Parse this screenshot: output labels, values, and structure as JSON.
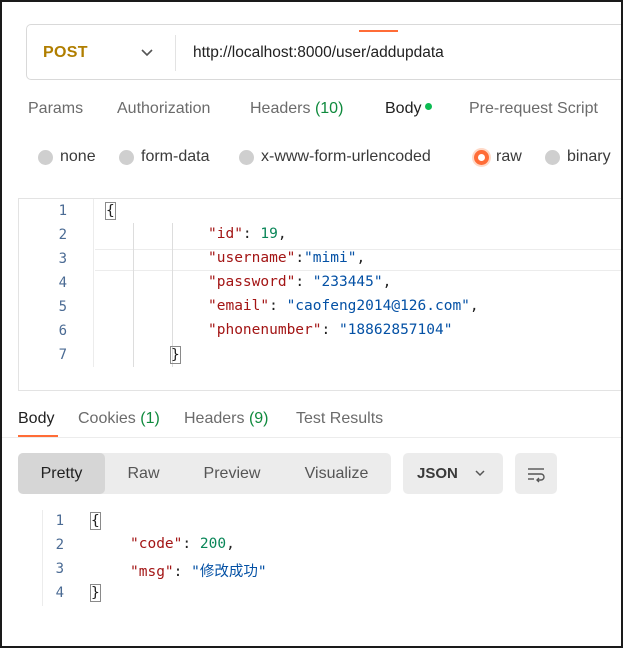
{
  "request": {
    "method": "POST",
    "method_dropdown_icon": "chevron-down-icon",
    "url": "http://localhost:8000/user/addupdata"
  },
  "request_tabs": [
    {
      "label": "Params"
    },
    {
      "label": "Authorization"
    },
    {
      "label": "Headers",
      "count": "(10)"
    },
    {
      "label": "Body",
      "active": true,
      "indicator_color": "#0cbb52"
    },
    {
      "label": "Pre-request Script"
    }
  ],
  "body_types": [
    {
      "label": "none"
    },
    {
      "label": "form-data"
    },
    {
      "label": "x-www-form-urlencoded"
    },
    {
      "label": "raw",
      "selected": true
    },
    {
      "label": "binary"
    }
  ],
  "request_body": {
    "line_numbers": [
      "1",
      "2",
      "3",
      "4",
      "5",
      "6",
      "7"
    ],
    "open_brace": "{",
    "close_brace": "}",
    "fields": [
      {
        "key": "\"id\"",
        "sep": ": ",
        "value": "19",
        "type": "num",
        "tail": ","
      },
      {
        "key": "\"username\"",
        "sep": ":",
        "value": "\"mimi\"",
        "type": "str",
        "tail": ","
      },
      {
        "key": "\"password\"",
        "sep": ": ",
        "value": "\"233445\"",
        "type": "str",
        "tail": ","
      },
      {
        "key": "\"email\"",
        "sep": ": ",
        "value": "\"caofeng2014@126.com\"",
        "type": "str",
        "tail": ","
      },
      {
        "key": "\"phonenumber\"",
        "sep": ": ",
        "value": "\"18862857104\"",
        "type": "str",
        "tail": ""
      }
    ]
  },
  "response_tabs": [
    {
      "label": "Body",
      "active": true
    },
    {
      "label": "Cookies",
      "count": "(1)"
    },
    {
      "label": "Headers",
      "count": "(9)"
    },
    {
      "label": "Test Results"
    }
  ],
  "response_views": [
    {
      "label": "Pretty",
      "active": true
    },
    {
      "label": "Raw"
    },
    {
      "label": "Preview"
    },
    {
      "label": "Visualize"
    }
  ],
  "response_format": "JSON",
  "wrap_icon": "wrap-lines-icon",
  "response_body": {
    "line_numbers": [
      "1",
      "2",
      "3",
      "4"
    ],
    "open_brace": "{",
    "close_brace": "}",
    "fields": [
      {
        "key": "\"code\"",
        "sep": ": ",
        "value": "200",
        "type": "num",
        "tail": ","
      },
      {
        "key": "\"msg\"",
        "sep": ": ",
        "value": "\"修改成功\"",
        "type": "str",
        "tail": ""
      }
    ]
  },
  "colors": {
    "accent": "#ff6c37",
    "method": "#b07e00",
    "count": "#0f8a3d",
    "json_key": "#a31515",
    "json_number": "#098658",
    "json_string": "#0451a5"
  }
}
